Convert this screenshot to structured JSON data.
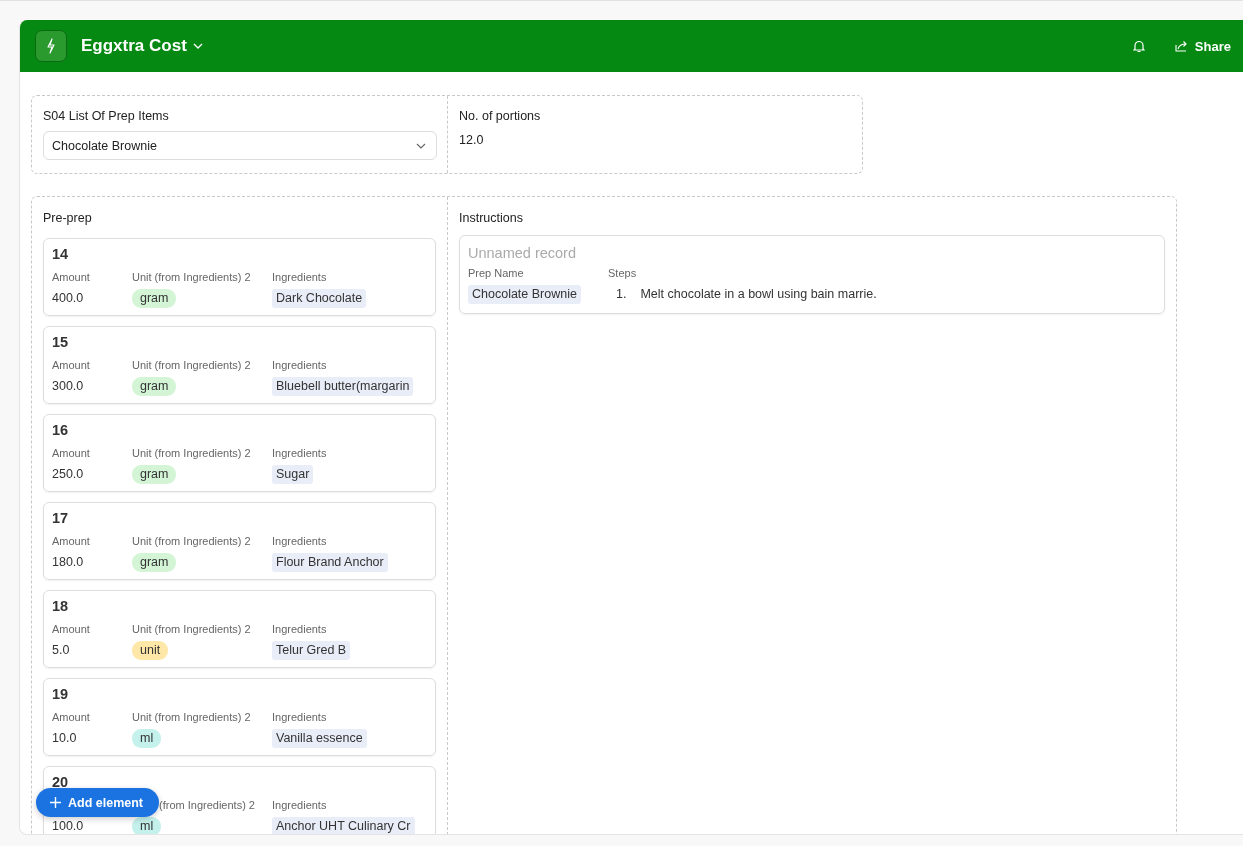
{
  "app": {
    "title": "Eggxtra Cost",
    "actions": [
      {
        "kind": "bell"
      },
      {
        "kind": "share",
        "label": "Share"
      }
    ]
  },
  "top_section": {
    "fields": [
      {
        "label": "S04 List Of Prep Items",
        "kind": "select",
        "value": "Chocolate Brownie"
      },
      {
        "label": "No. of portions",
        "kind": "text",
        "value": "12.0"
      }
    ]
  },
  "pre_prep": {
    "title": "Pre-prep",
    "cards": [
      {
        "title": "14",
        "amount_label": "Amount",
        "amount": "400.0",
        "unit_label": "Unit (from Ingredients) 2",
        "unit": {
          "label": "gram",
          "color": "#d3f5d6"
        },
        "ingredients_label": "Ingredients",
        "ingredient": "Dark Chocolate"
      },
      {
        "title": "15",
        "amount_label": "Amount",
        "amount": "300.0",
        "unit_label": "Unit (from Ingredients) 2",
        "unit": {
          "label": "gram",
          "color": "#d3f5d6"
        },
        "ingredients_label": "Ingredients",
        "ingredient": "Bluebell butter(margarin"
      },
      {
        "title": "16",
        "amount_label": "Amount",
        "amount": "250.0",
        "unit_label": "Unit (from Ingredients) 2",
        "unit": {
          "label": "gram",
          "color": "#d3f5d6"
        },
        "ingredients_label": "Ingredients",
        "ingredient": "Sugar"
      },
      {
        "title": "17",
        "amount_label": "Amount",
        "amount": "180.0",
        "unit_label": "Unit (from Ingredients) 2",
        "unit": {
          "label": "gram",
          "color": "#d3f5d6"
        },
        "ingredients_label": "Ingredients",
        "ingredient": "Flour Brand Anchor"
      },
      {
        "title": "18",
        "amount_label": "Amount",
        "amount": "5.0",
        "unit_label": "Unit (from Ingredients) 2",
        "unit": {
          "label": "unit",
          "color": "#ffe7a8"
        },
        "ingredients_label": "Ingredients",
        "ingredient": "Telur Gred B"
      },
      {
        "title": "19",
        "amount_label": "Amount",
        "amount": "10.0",
        "unit_label": "Unit (from Ingredients) 2",
        "unit": {
          "label": "ml",
          "color": "#c4f1ec"
        },
        "ingredients_label": "Ingredients",
        "ingredient": "Vanilla essence"
      },
      {
        "title": "20",
        "unit_label": "(from Ingredients) 2",
        "amount": "100.0",
        "unit": {
          "label": "ml",
          "color": "#c4f1ec"
        },
        "ingredients_label": "Ingredients",
        "ingredient": "Anchor UHT Culinary Cr"
      }
    ]
  },
  "instructions": {
    "title": "Instructions",
    "records": [
      {
        "title": "Unnamed record",
        "prep_label": "Prep Name",
        "prep": "Chocolate Brownie",
        "steps_label": "Steps",
        "steps": [
          {
            "number": "1.",
            "text": "Melt chocolate in a bowl using bain marrie."
          }
        ]
      }
    ]
  },
  "add_button": {
    "label": "Add element"
  }
}
